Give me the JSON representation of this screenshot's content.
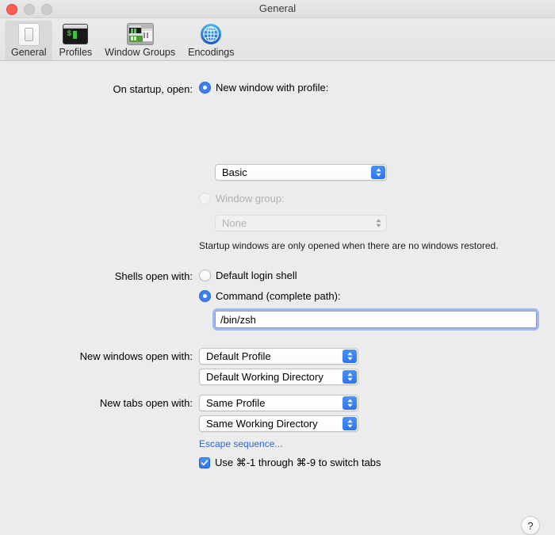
{
  "window": {
    "title": "General",
    "traffic_lights": [
      "close-button",
      "minimize-button",
      "zoom-button"
    ]
  },
  "toolbar": {
    "items": [
      {
        "label": "General",
        "icon": "general-icon",
        "selected": true
      },
      {
        "label": "Profiles",
        "icon": "terminal-icon",
        "selected": false
      },
      {
        "label": "Window Groups",
        "icon": "window-groups-icon",
        "selected": false
      },
      {
        "label": "Encodings",
        "icon": "globe-icon",
        "selected": false
      }
    ]
  },
  "settings": {
    "on_startup": {
      "label": "On startup, open:",
      "option_new_window": {
        "label": "New window with profile:",
        "selected": true,
        "popup_value": "Basic"
      },
      "option_window_group": {
        "label": "Window group:",
        "selected": false,
        "disabled": true,
        "popup_value": "None"
      },
      "hint": "Startup windows are only opened when there are no windows restored."
    },
    "shells_open_with": {
      "label": "Shells open with:",
      "option_default_shell": {
        "label": "Default login shell",
        "selected": false
      },
      "option_command": {
        "label": "Command (complete path):",
        "selected": true,
        "field_value": "/bin/zsh",
        "field_placeholder": "/bin/zsh"
      }
    },
    "new_windows_open_with": {
      "label": "New windows open with:",
      "profile_value": "Default Profile",
      "directory_value": "Default Working Directory"
    },
    "new_tabs_open_with": {
      "label": "New tabs open with:",
      "profile_value": "Same Profile",
      "directory_value": "Same Working Directory"
    },
    "escape_sequence_link": "Escape sequence...",
    "switch_tabs_checkbox": {
      "label": "Use ⌘-1 through ⌘-9 to switch tabs",
      "checked": true
    }
  },
  "help": {
    "label": "?"
  }
}
